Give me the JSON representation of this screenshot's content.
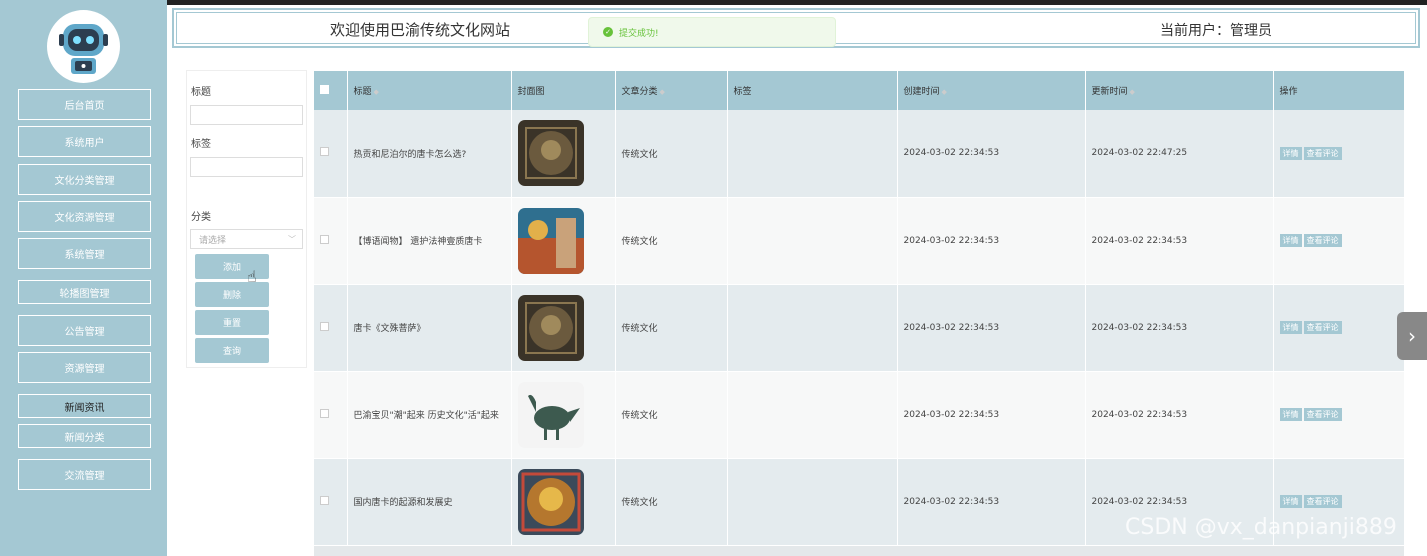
{
  "sidebar": {
    "items": [
      {
        "label": "后台首页"
      },
      {
        "label": "系统用户"
      },
      {
        "label": "文化分类管理"
      },
      {
        "label": "文化资源管理"
      },
      {
        "label": "系统管理"
      },
      {
        "label": "轮播图管理"
      },
      {
        "label": "公告管理"
      },
      {
        "label": "资源管理"
      },
      {
        "label": "新闻资讯"
      },
      {
        "label": "新闻分类"
      },
      {
        "label": "交流管理"
      }
    ]
  },
  "header": {
    "title": "欢迎使用巴渝传统文化网站",
    "current_user": "当前用户：管理员"
  },
  "toast": {
    "message": "提交成功!",
    "icon": "check-circle-icon"
  },
  "search": {
    "title_label": "标题",
    "tag_label": "标签",
    "category_label": "分类",
    "category_placeholder": "请选择",
    "buttons": {
      "add": "添加",
      "delete": "删除",
      "reset": "重置",
      "query": "查询"
    }
  },
  "table": {
    "headers": {
      "title": "标题",
      "cover": "封面图",
      "category": "文章分类",
      "tags": "标签",
      "created": "创建时间",
      "updated": "更新时间",
      "actions": "操作"
    },
    "rows": [
      {
        "title": "热贡和尼泊尔的唐卡怎么选?",
        "category": "传统文化",
        "tags": "",
        "created": "2024-03-02 22:34:53",
        "updated": "2024-03-02 22:47:25",
        "detail": "详情",
        "comments": "查看评论"
      },
      {
        "title": "【博语闻物】 遗护法神壹质唐卡",
        "category": "传统文化",
        "tags": "",
        "created": "2024-03-02 22:34:53",
        "updated": "2024-03-02 22:34:53",
        "detail": "详情",
        "comments": "查看评论"
      },
      {
        "title": "唐卡《文殊菩萨》",
        "category": "传统文化",
        "tags": "",
        "created": "2024-03-02 22:34:53",
        "updated": "2024-03-02 22:34:53",
        "detail": "详情",
        "comments": "查看评论"
      },
      {
        "title": "巴渝宝贝\"潮\"起来 历史文化\"活\"起来",
        "category": "传统文化",
        "tags": "",
        "created": "2024-03-02 22:34:53",
        "updated": "2024-03-02 22:34:53",
        "detail": "详情",
        "comments": "查看评论"
      },
      {
        "title": "国内唐卡的起源和发展史",
        "category": "传统文化",
        "tags": "",
        "created": "2024-03-02 22:34:53",
        "updated": "2024-03-02 22:34:53",
        "detail": "详情",
        "comments": "查看评论"
      }
    ]
  },
  "watermark": "CSDN @vx_danpianji889"
}
